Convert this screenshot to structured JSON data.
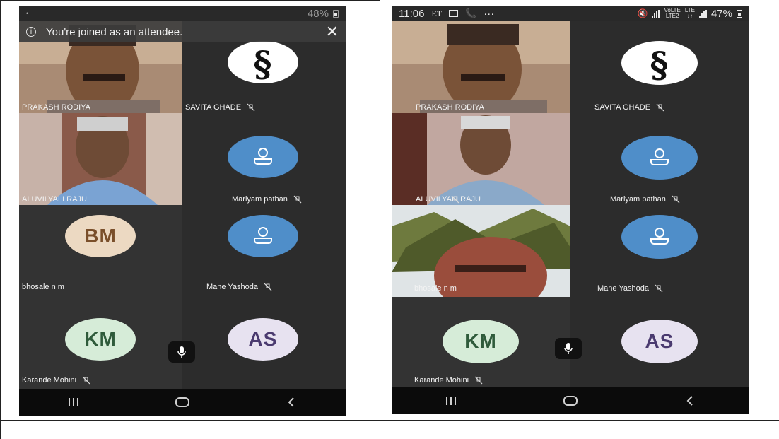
{
  "left_phone": {
    "status_bar": {
      "battery": "48%"
    },
    "banner": {
      "text": "You're joined as an attendee.",
      "close": "✕",
      "info": "i"
    },
    "participants": [
      {
        "name": "PRAKASH RODIYA",
        "muted": false
      },
      {
        "name": "SAVITA GHADE",
        "muted": true
      },
      {
        "name": "ALUVILYALI RAJU",
        "muted": false
      },
      {
        "name": "Mariyam pathan",
        "muted": true
      },
      {
        "name": "bhosale n m",
        "initials": "BM",
        "muted": false
      },
      {
        "name": "Mane Yashoda",
        "muted": true
      },
      {
        "name": "Karande Mohini",
        "initials": "KM",
        "muted": true
      },
      {
        "name": "",
        "initials": "AS",
        "muted": false
      }
    ]
  },
  "right_phone": {
    "status_bar": {
      "time": "11:06",
      "carrier": "ET",
      "network_top": "VoLTE",
      "network_bottom": "LTE2",
      "lte": "LTE",
      "lte_arrows": "↓↑",
      "dots": "···",
      "battery": "47%"
    },
    "participants": [
      {
        "name": "PRAKASH RODIYA",
        "muted": false
      },
      {
        "name": "SAVITA GHADE",
        "muted": true
      },
      {
        "name": "ALUVILYALI RAJU",
        "muted": true
      },
      {
        "name": "Mariyam pathan",
        "muted": true
      },
      {
        "name": "bhosale n m",
        "muted": false
      },
      {
        "name": "Mane Yashoda",
        "muted": true
      },
      {
        "name": "Karande Mohini",
        "initials": "KM",
        "muted": true
      },
      {
        "name": "",
        "initials": "AS",
        "muted": false
      }
    ]
  },
  "colors": {
    "tile_bg": "#2c2c2c",
    "generic_avatar": "#4f8ec9",
    "navbar": "#0b0b0b"
  },
  "icons": [
    "mute-icon",
    "mic-icon",
    "recent-apps-icon",
    "home-icon",
    "back-icon",
    "person-icon",
    "section-logo-icon",
    "info-icon",
    "close-icon",
    "battery-icon",
    "signal-icon"
  ]
}
